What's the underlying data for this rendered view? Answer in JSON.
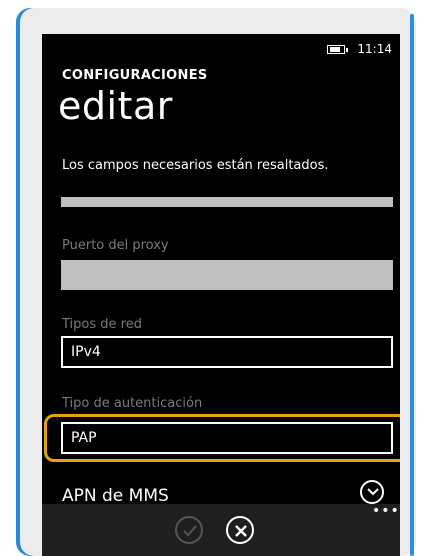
{
  "status": {
    "time": "11:14",
    "battery_icon": "battery-charging-icon"
  },
  "header": {
    "app_title": "CONFIGURACIONES",
    "page_title": "editar"
  },
  "hint": "Los campos necesarios están resaltados.",
  "fields": {
    "proxy_port": {
      "label": "Puerto del proxy",
      "value": ""
    },
    "network_types": {
      "label": "Tipos de red",
      "value": "IPv4"
    },
    "auth_type": {
      "label": "Tipo de autenticación",
      "value": "PAP"
    }
  },
  "section": {
    "apn_mms": "APN de MMS"
  },
  "appbar": {
    "more": "•••"
  },
  "colors": {
    "highlight": "#e8a20f",
    "accent_edge": "#2f8fdc",
    "background": "#000000"
  }
}
